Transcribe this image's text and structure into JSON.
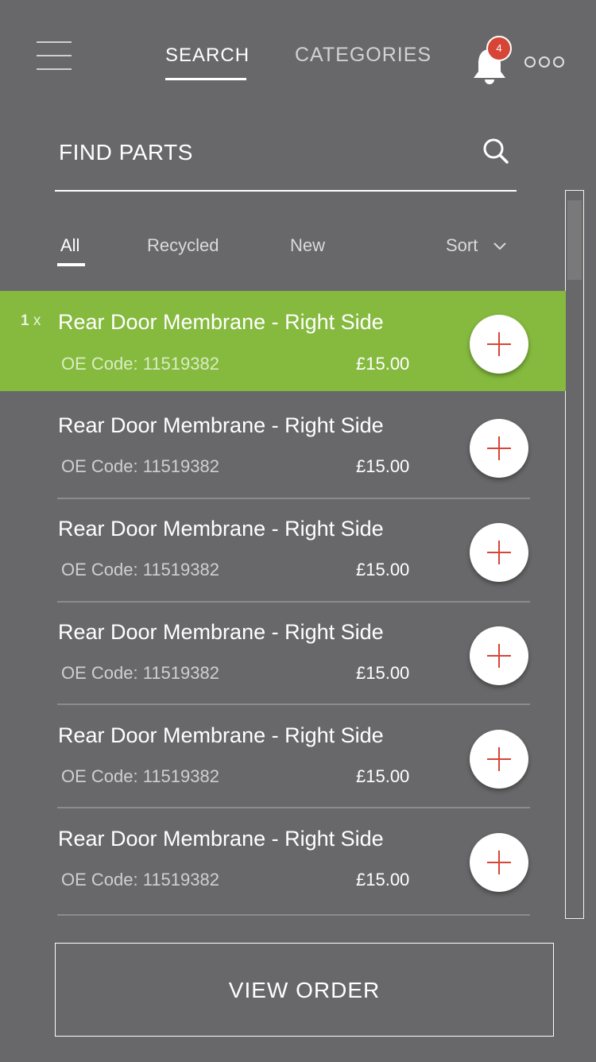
{
  "header": {
    "tabs": [
      {
        "label": "SEARCH",
        "active": true
      },
      {
        "label": "CATEGORIES",
        "active": false
      }
    ],
    "notifications_count": "4",
    "icons": {
      "menu": "hamburger-menu-icon",
      "bell": "bell-icon",
      "more": "more-dots-icon"
    }
  },
  "search": {
    "placeholder": "FIND PARTS",
    "icon": "search-icon"
  },
  "filters": {
    "items": [
      {
        "label": "All",
        "active": true
      },
      {
        "label": "Recycled",
        "active": false
      },
      {
        "label": "New",
        "active": false
      }
    ],
    "sort_label": "Sort"
  },
  "list": {
    "items": [
      {
        "title": "Rear Door Membrane - Right Side",
        "code": "OE Code: 11519382",
        "price": "£15.00",
        "selected": true,
        "qty": "1",
        "qty_suffix": "x"
      },
      {
        "title": "Rear Door Membrane - Right Side",
        "code": "OE Code: 11519382",
        "price": "£15.00",
        "selected": false
      },
      {
        "title": "Rear Door Membrane - Right Side",
        "code": "OE Code: 11519382",
        "price": "£15.00",
        "selected": false
      },
      {
        "title": "Rear Door Membrane - Right Side",
        "code": "OE Code: 11519382",
        "price": "£15.00",
        "selected": false
      },
      {
        "title": "Rear Door Membrane - Right Side",
        "code": "OE Code: 11519382",
        "price": "£15.00",
        "selected": false
      },
      {
        "title": "Rear Door Membrane - Right Side",
        "code": "OE Code: 11519382",
        "price": "£15.00",
        "selected": false
      }
    ]
  },
  "footer": {
    "view_order_label": "VIEW ORDER"
  },
  "colors": {
    "background": "#68686a",
    "selected_row": "#85ba3e",
    "accent_red": "#d64535"
  }
}
